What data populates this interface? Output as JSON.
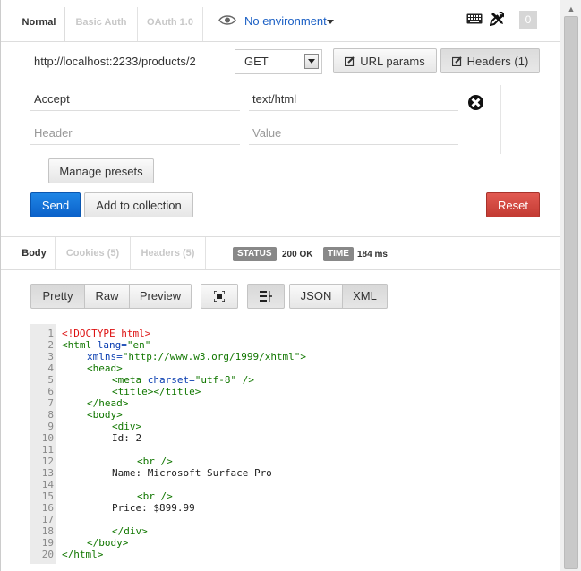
{
  "tabs": [
    "Normal",
    "Basic Auth",
    "OAuth 1.0"
  ],
  "environment": {
    "label": "No environment"
  },
  "notifications_count": "0",
  "request": {
    "url": "http://localhost:2233/products/2",
    "method": "GET",
    "url_params_label": "URL params",
    "headers_label": "Headers (1)"
  },
  "headers": {
    "rows": [
      {
        "key": "Accept",
        "value": "text/html"
      }
    ],
    "key_placeholder": "Header",
    "value_placeholder": "Value"
  },
  "actions": {
    "manage_presets": "Manage presets",
    "send": "Send",
    "add_to_collection": "Add to collection",
    "reset": "Reset"
  },
  "response_tabs": [
    "Body",
    "Cookies (5)",
    "Headers (5)"
  ],
  "status": {
    "label": "STATUS",
    "value": "200 OK"
  },
  "time": {
    "label": "TIME",
    "value": "184 ms"
  },
  "view_modes": [
    "Pretty",
    "Raw",
    "Preview"
  ],
  "formats": [
    "JSON",
    "XML"
  ],
  "colors": {
    "send": "#1a73d9",
    "reset": "#d2433b",
    "link": "#1a5fc4"
  },
  "code_lines": [
    {
      "n": "1",
      "indent": 0,
      "parts": [
        {
          "t": "<!DOCTYPE html>",
          "c": "red"
        }
      ]
    },
    {
      "n": "2",
      "indent": 0,
      "parts": [
        {
          "t": "<html",
          "c": "green"
        },
        {
          "t": " lang=",
          "c": "blue"
        },
        {
          "t": "\"en\"",
          "c": "green"
        }
      ]
    },
    {
      "n": "3",
      "indent": 4,
      "parts": [
        {
          "t": "xmlns=",
          "c": "blue"
        },
        {
          "t": "\"http://www.w3.org/1999/xhtml\">",
          "c": "green"
        }
      ]
    },
    {
      "n": "4",
      "indent": 4,
      "parts": [
        {
          "t": "<head>",
          "c": "green"
        }
      ]
    },
    {
      "n": "5",
      "indent": 8,
      "parts": [
        {
          "t": "<meta",
          "c": "green"
        },
        {
          "t": " charset=",
          "c": "blue"
        },
        {
          "t": "\"utf-8\" />",
          "c": "green"
        }
      ]
    },
    {
      "n": "6",
      "indent": 8,
      "parts": [
        {
          "t": "<title></title>",
          "c": "green"
        }
      ]
    },
    {
      "n": "7",
      "indent": 4,
      "parts": [
        {
          "t": "</head>",
          "c": "green"
        }
      ]
    },
    {
      "n": "8",
      "indent": 4,
      "parts": [
        {
          "t": "<body>",
          "c": "green"
        }
      ]
    },
    {
      "n": "9",
      "indent": 8,
      "parts": [
        {
          "t": "<div>",
          "c": "green"
        }
      ]
    },
    {
      "n": "10",
      "indent": 8,
      "parts": [
        {
          "t": "Id: 2",
          "c": "text"
        }
      ]
    },
    {
      "n": "11",
      "indent": 0,
      "parts": []
    },
    {
      "n": "12",
      "indent": 12,
      "parts": [
        {
          "t": "<br />",
          "c": "green"
        }
      ]
    },
    {
      "n": "13",
      "indent": 8,
      "parts": [
        {
          "t": "Name: Microsoft Surface Pro",
          "c": "text"
        }
      ]
    },
    {
      "n": "14",
      "indent": 0,
      "parts": []
    },
    {
      "n": "15",
      "indent": 12,
      "parts": [
        {
          "t": "<br />",
          "c": "green"
        }
      ]
    },
    {
      "n": "16",
      "indent": 8,
      "parts": [
        {
          "t": "Price: $899.99",
          "c": "text"
        }
      ]
    },
    {
      "n": "17",
      "indent": 0,
      "parts": []
    },
    {
      "n": "18",
      "indent": 8,
      "parts": [
        {
          "t": "</div>",
          "c": "green"
        }
      ]
    },
    {
      "n": "19",
      "indent": 4,
      "parts": [
        {
          "t": "</body>",
          "c": "green"
        }
      ]
    },
    {
      "n": "20",
      "indent": 0,
      "parts": [
        {
          "t": "</html>",
          "c": "green"
        }
      ]
    }
  ]
}
